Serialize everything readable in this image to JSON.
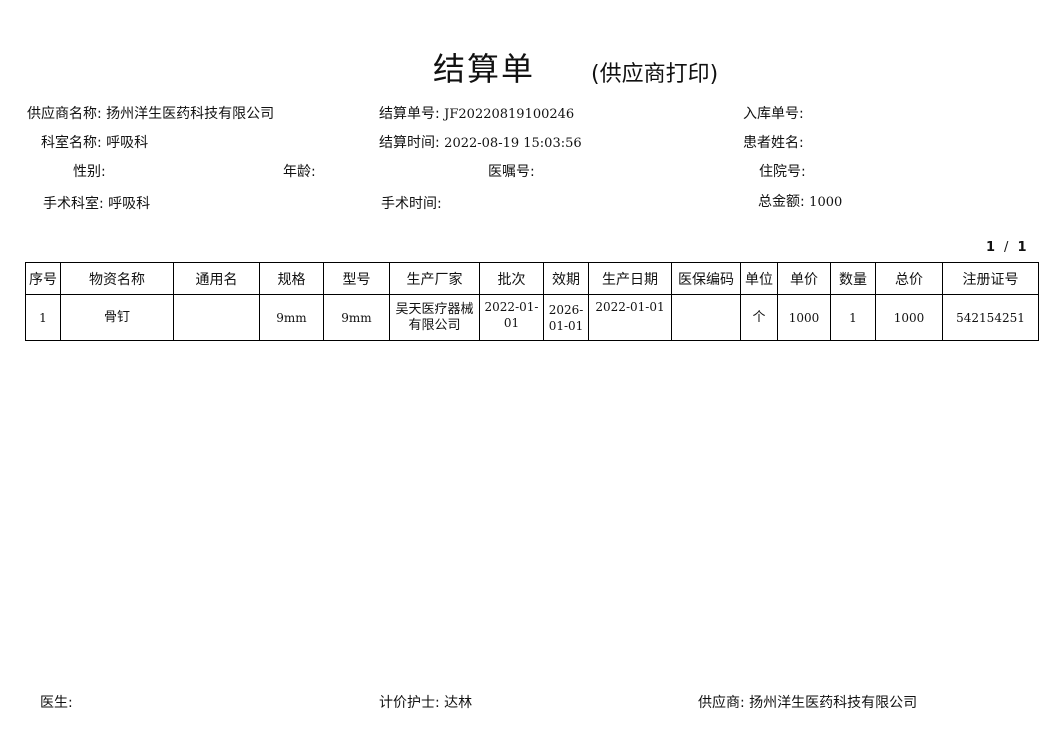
{
  "title": "结算单",
  "subtitle": "(供应商打印)",
  "header": {
    "supplier_label": "供应商名称:",
    "supplier_value": "扬州洋生医药科技有限公司",
    "settlement_no_label": "结算单号:",
    "settlement_no_value": "JF20220819100246",
    "inbound_no_label": "入库单号:",
    "inbound_no_value": "",
    "department_label": "科室名称:",
    "department_value": "呼吸科",
    "settlement_time_label": "结算时间:",
    "settlement_time_value": "2022-08-19 15:03:56",
    "patient_label": "患者姓名:",
    "patient_value": "",
    "gender_label": "性别:",
    "gender_value": "",
    "age_label": "年龄:",
    "age_value": "",
    "order_no_label": "医嘱号:",
    "order_no_value": "",
    "admission_no_label": "住院号:",
    "admission_no_value": "",
    "surgery_dept_label": "手术科室:",
    "surgery_dept_value": "呼吸科",
    "surgery_time_label": "手术时间:",
    "surgery_time_value": "",
    "total_label": "总金额:",
    "total_value": "1000"
  },
  "pagination": {
    "current": "1",
    "separator": "/",
    "total": "1"
  },
  "table": {
    "headers": [
      "序号",
      "物资名称",
      "通用名",
      "规格",
      "型号",
      "生产厂家",
      "批次",
      "效期",
      "生产日期",
      "医保编码",
      "单位",
      "单价",
      "数量",
      "总价",
      "注册证号"
    ],
    "rows": [
      [
        "1",
        "骨钉",
        "",
        "9mm",
        "9mm",
        "吴天医疗器械有限公司",
        "2022-01-01",
        "2026-01-01",
        "2022-01-01",
        "",
        "个",
        "1000",
        "1",
        "1000",
        "542154251"
      ]
    ]
  },
  "footer": {
    "doctor_label": "医生:",
    "doctor_value": "",
    "nurse_label": "计价护士:",
    "nurse_value": "达林",
    "supplier_label": "供应商:",
    "supplier_value": "扬州洋生医药科技有限公司"
  }
}
